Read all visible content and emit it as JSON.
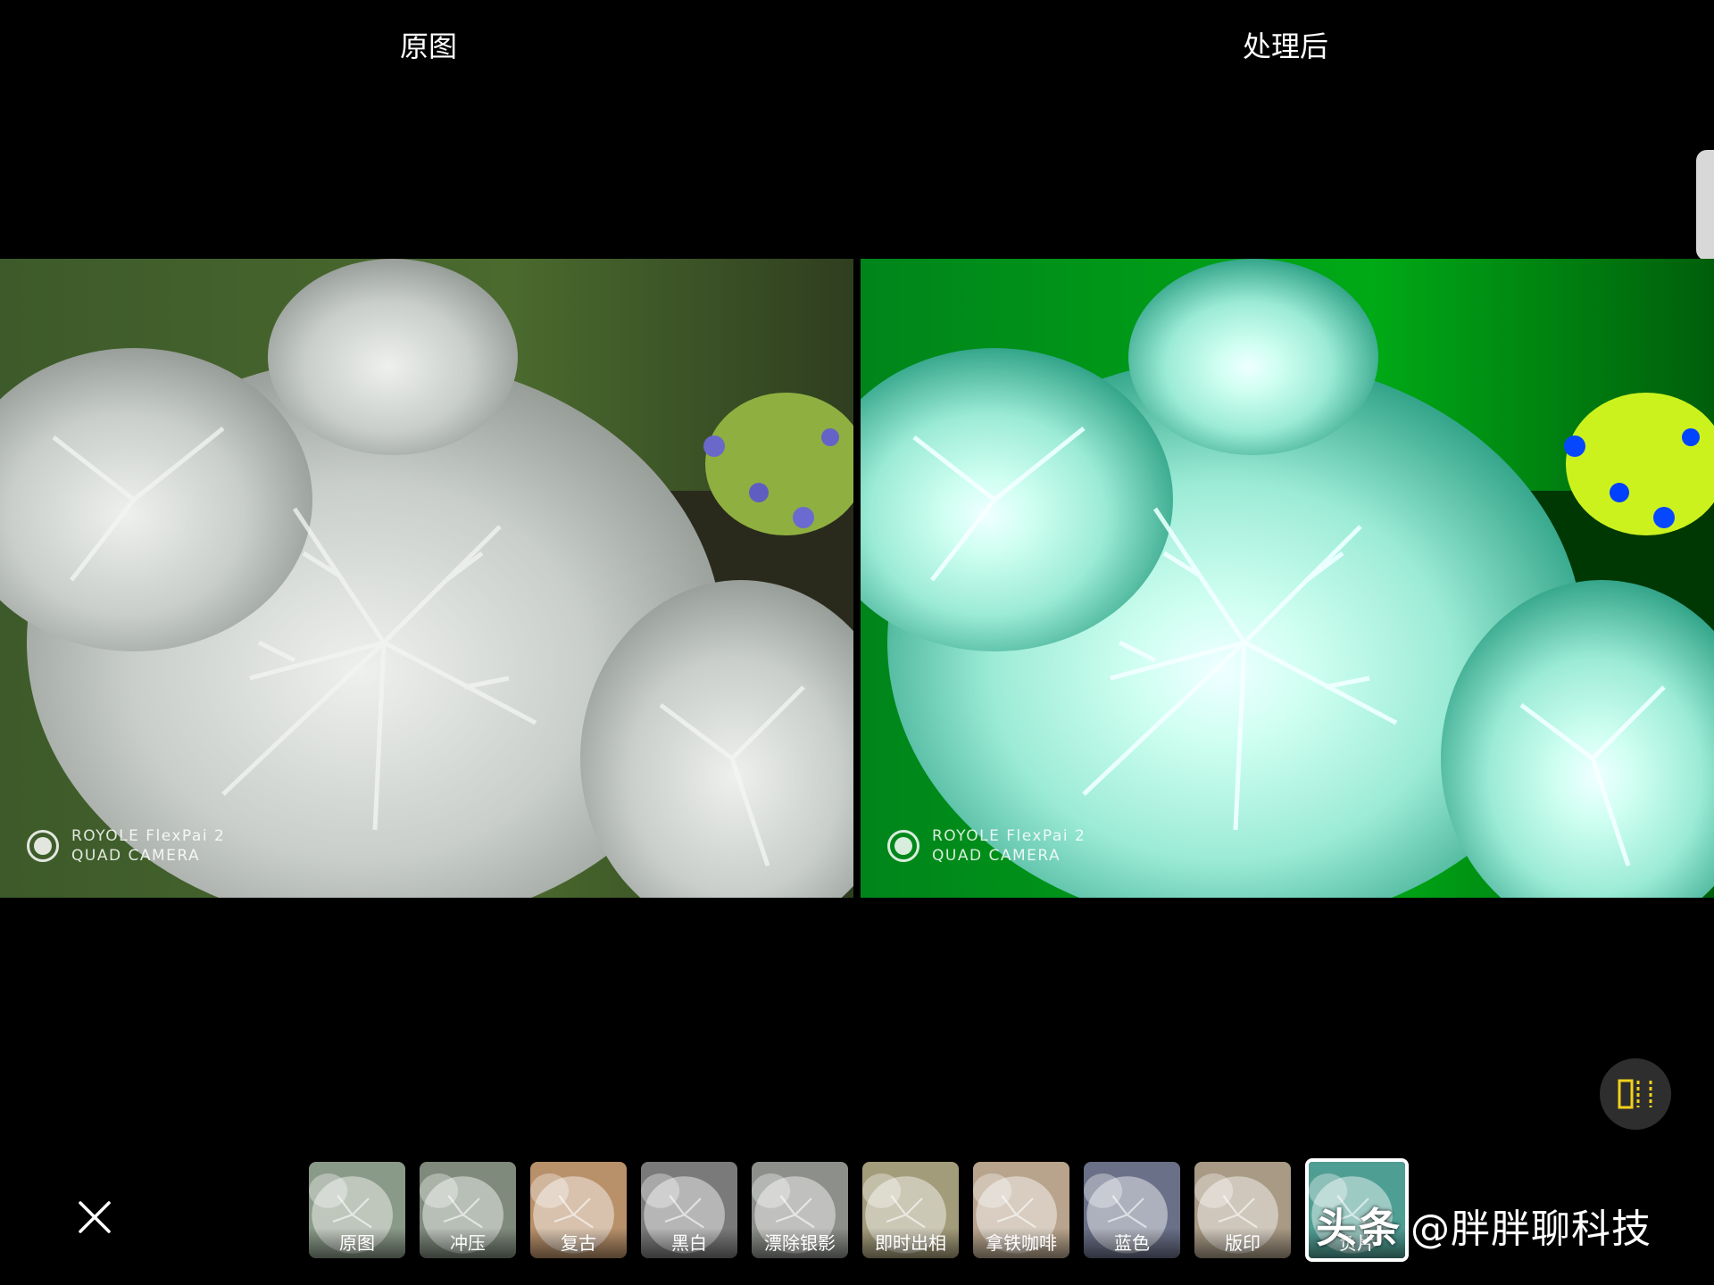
{
  "panes": {
    "left_title": "原图",
    "right_title": "处理后"
  },
  "watermark": {
    "line1": "ROYOLE FlexPai 2",
    "line2": "QUAD CAMERA"
  },
  "filters": [
    {
      "label": "原图",
      "tint": "#8a9a88"
    },
    {
      "label": "冲压",
      "tint": "#7f8a7c"
    },
    {
      "label": "复古",
      "tint": "#b8906a"
    },
    {
      "label": "黑白",
      "tint": "#7a7a7a"
    },
    {
      "label": "漂除银影",
      "tint": "#8c8f8a"
    },
    {
      "label": "即时出相",
      "tint": "#a39c7a"
    },
    {
      "label": "拿铁咖啡",
      "tint": "#b8a48c"
    },
    {
      "label": "蓝色",
      "tint": "#6a7088"
    },
    {
      "label": "版印",
      "tint": "#a89a84"
    },
    {
      "label": "负片",
      "tint": "#4f9e94",
      "selected": true
    }
  ],
  "brand": {
    "mark": "头条",
    "handle": "@胖胖聊科技"
  },
  "icons": {
    "close": "close-icon",
    "compare": "compare-split-icon"
  },
  "colors": {
    "background": "#000000",
    "compare_icon": "#f2d21b",
    "selected_border": "#ffffff"
  }
}
